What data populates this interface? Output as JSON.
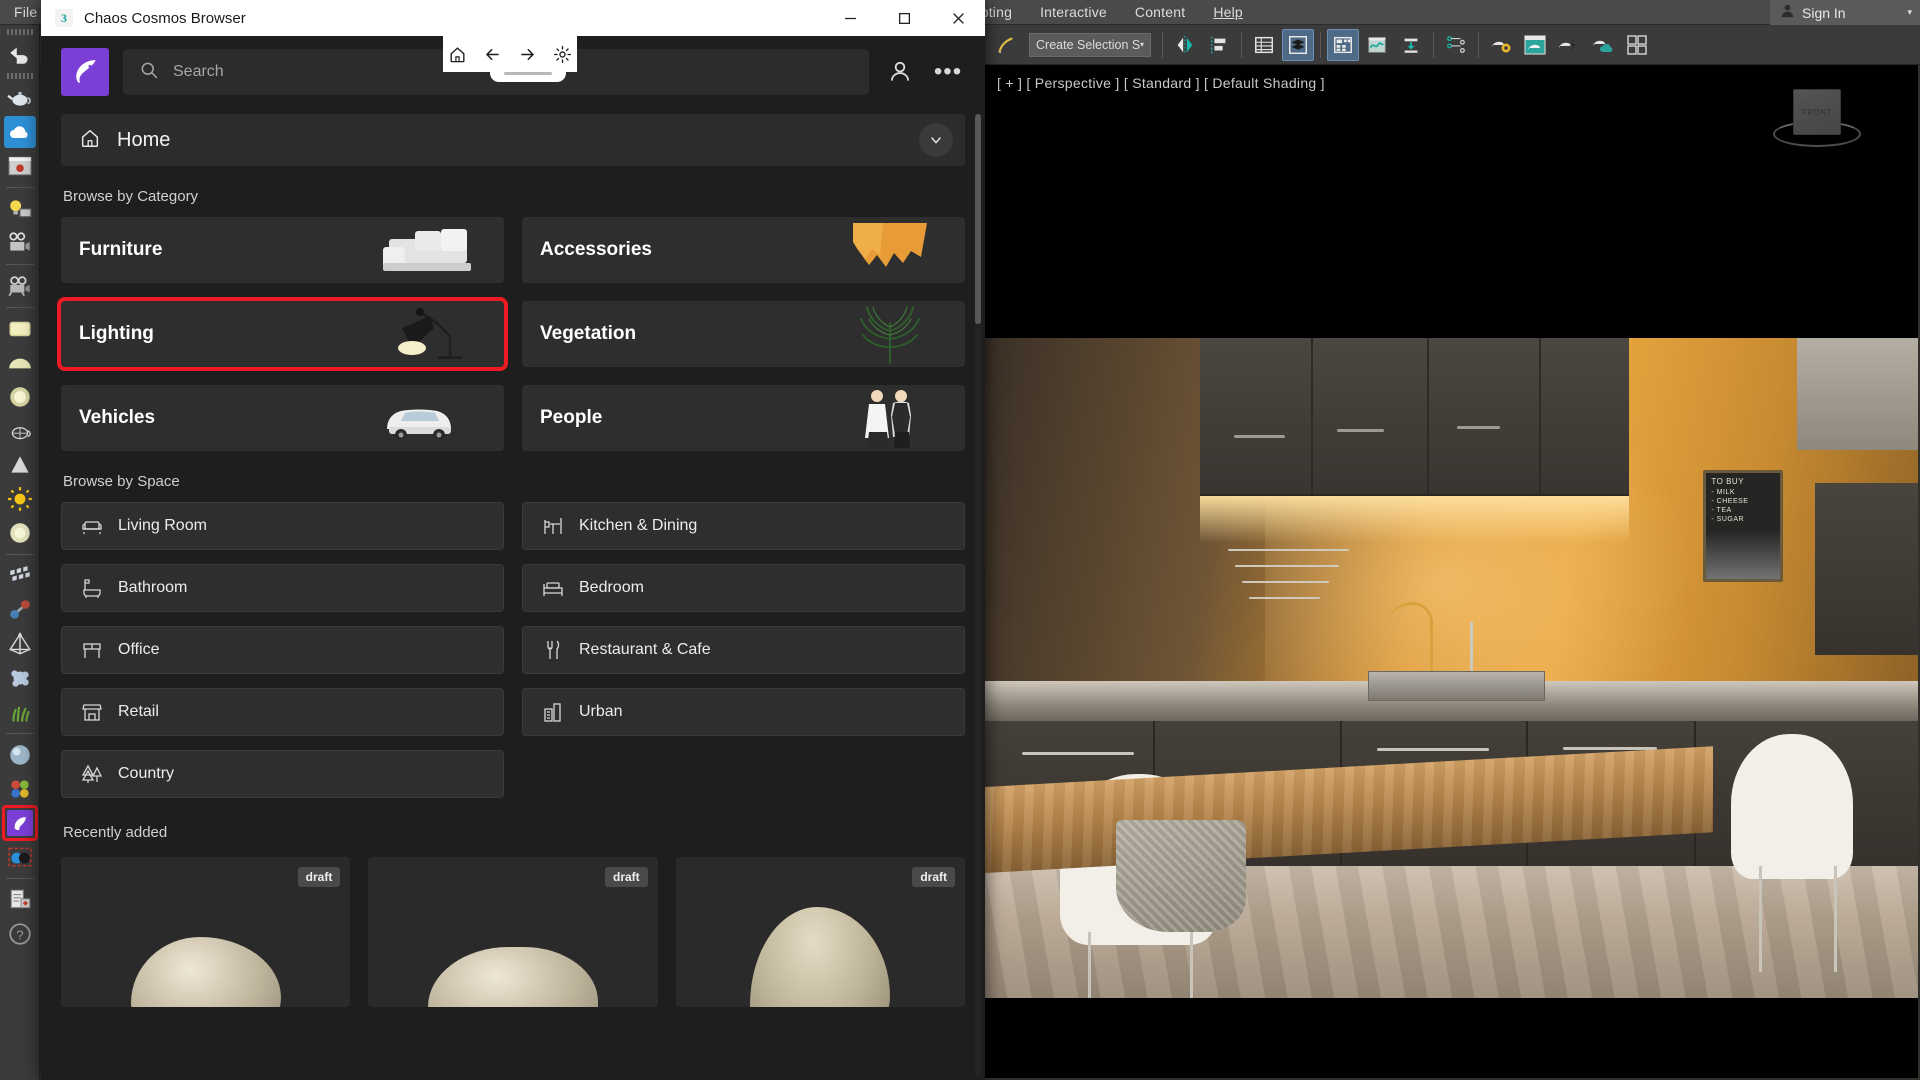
{
  "host": {
    "menubar": [
      "File",
      "cripting",
      "Interactive",
      "Content",
      "Help"
    ],
    "menubar_full": [
      "File",
      "Scripting",
      "Interactive",
      "Content",
      "Help"
    ],
    "signin": {
      "label": "Sign In",
      "icon": "user-icon",
      "caret": "▾"
    },
    "toolbar": {
      "selection_set": {
        "value": "Create Selection Se",
        "caret": "▾"
      },
      "icons": [
        "snapshot-icon",
        "mirror-icon",
        "align-icon",
        "layer-explorer-icon",
        "layer-manager-icon",
        "ribbon-icon",
        "curve-editor-icon",
        "schematic-view-icon",
        "material-editor-icon",
        "render-setup-icon",
        "rendered-frame-icon",
        "render-production-icon",
        "render-iterative-icon",
        "render-in-cloud-icon"
      ]
    },
    "left_toolbar": {
      "icons": [
        "undo-icon",
        "teapot-icon",
        "cloud-upload-icon",
        "render-frame-icon",
        "light-lister-icon",
        "camera-setup-icon",
        "camera-icon",
        "plane-light-icon",
        "dome-light-icon",
        "sphere-light-icon",
        "mesh-light-icon",
        "cone-light-icon",
        "sun-icon",
        "ies-light-icon",
        "proxy-icon",
        "atoms-icon",
        "pyramid-icon",
        "particle-icon",
        "fur-icon",
        "material-sphere-icon",
        "multi-material-icon",
        "cosmos-browser-icon",
        "toon-material-icon",
        "clipboard-icon",
        "help-icon"
      ],
      "highlighted_icon": "cosmos-browser-icon",
      "highlight_color": "#ee1b24"
    },
    "viewport": {
      "label": "[ + ] [ Perspective ] [ Standard ] [ Default Shading ]",
      "viewcube_face": "FRONT",
      "chalkboard": {
        "title": "TO BUY",
        "items": [
          "- MILK",
          "- CHEESE",
          "- TEA",
          "- SUGAR"
        ]
      }
    }
  },
  "cosmos": {
    "title": "Chaos Cosmos Browser",
    "app_icon_glyph": "3",
    "window_controls": {
      "minimize": "minimize-icon",
      "maximize": "maximize-icon",
      "close": "close-icon"
    },
    "nav_pill": [
      "home-icon",
      "back-icon",
      "forward-icon",
      "settings-icon"
    ],
    "search": {
      "placeholder": "Search",
      "value": "",
      "icon": "search-icon"
    },
    "account_icon": "user-account-icon",
    "overflow_icon": "more-options-icon",
    "breadcrumb": {
      "label": "Home",
      "icon": "home-icon",
      "expand_icon": "chevron-down-icon"
    },
    "sections": {
      "category": {
        "title": "Browse by Category",
        "items": [
          {
            "label": "Furniture",
            "thumb": "sofa-thumbnail",
            "selected": false
          },
          {
            "label": "Accessories",
            "thumb": "fabric-thumbnail",
            "selected": false
          },
          {
            "label": "Lighting",
            "thumb": "desk-lamp-thumbnail",
            "selected": true
          },
          {
            "label": "Vegetation",
            "thumb": "palm-plant-thumbnail",
            "selected": false
          },
          {
            "label": "Vehicles",
            "thumb": "white-car-thumbnail",
            "selected": false
          },
          {
            "label": "People",
            "thumb": "two-people-thumbnail",
            "selected": false
          }
        ]
      },
      "space": {
        "title": "Browse by Space",
        "items": [
          {
            "label": "Living Room",
            "icon": "armchair-icon"
          },
          {
            "label": "Kitchen & Dining",
            "icon": "table-chairs-icon"
          },
          {
            "label": "Bathroom",
            "icon": "bathtub-icon"
          },
          {
            "label": "Bedroom",
            "icon": "bed-icon"
          },
          {
            "label": "Office",
            "icon": "desk-icon"
          },
          {
            "label": "Restaurant & Cafe",
            "icon": "cutlery-icon"
          },
          {
            "label": "Retail",
            "icon": "shop-icon"
          },
          {
            "label": "Urban",
            "icon": "buildings-icon"
          },
          {
            "label": "Country",
            "icon": "trees-icon"
          }
        ]
      },
      "recent": {
        "title": "Recently added",
        "items": [
          {
            "badge": "draft",
            "thumb": "rock-thumbnail"
          },
          {
            "badge": "draft",
            "thumb": "rock-thumbnail"
          },
          {
            "badge": "draft",
            "thumb": "rock-thumbnail"
          }
        ]
      }
    }
  },
  "colors": {
    "accent_purple": "#7c3fd6",
    "highlight_red": "#ee1b24",
    "panel_bg": "#1e1e1e",
    "card_bg": "#2e2e2e",
    "host_bg": "#3b3b3b"
  }
}
